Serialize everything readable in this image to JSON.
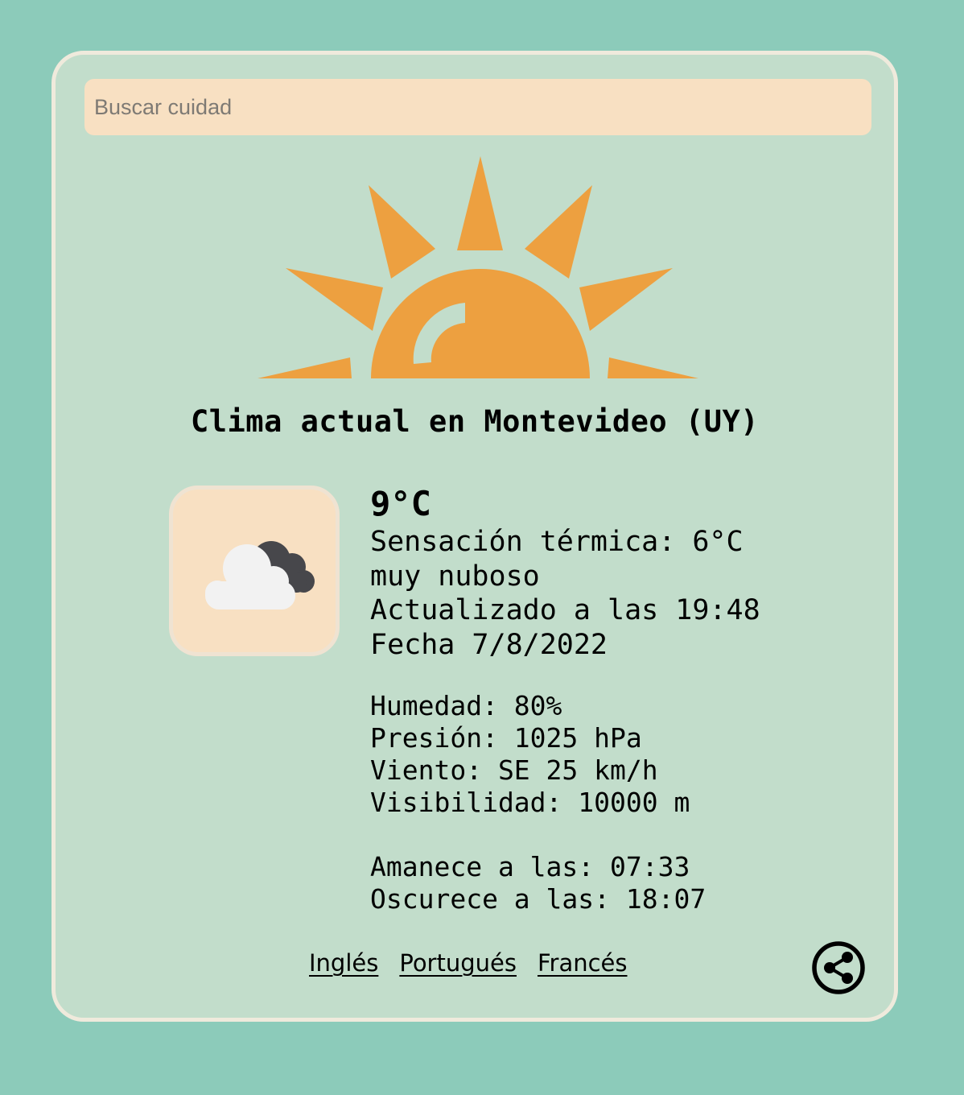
{
  "search": {
    "placeholder": "Buscar cuidad"
  },
  "weather": {
    "title": "Clima actual en Montevideo (UY)",
    "temperature": "9°C",
    "feels_like": "Sensación térmica: 6°C",
    "description": "muy nuboso",
    "updated": "Actualizado a las 19:48",
    "date": "Fecha 7/8/2022",
    "humidity": "Humedad: 80%",
    "pressure": "Presión: 1025 hPa",
    "wind": "Viento: SE 25 km/h",
    "visibility": "Visibilidad: 10000 m",
    "sunrise": "Amanece a las: 07:33",
    "sunset": "Oscurece a las: 18:07",
    "icon": "cloudy-icon"
  },
  "languages": [
    "Inglés",
    "Portugués",
    "Francés"
  ],
  "share": {
    "icon": "share-icon"
  },
  "colors": {
    "background": "#8ccbba",
    "card": "#c2ddcb",
    "card_border": "#efeadc",
    "input_bg": "#f8e0c2",
    "sun": "#eda040"
  }
}
